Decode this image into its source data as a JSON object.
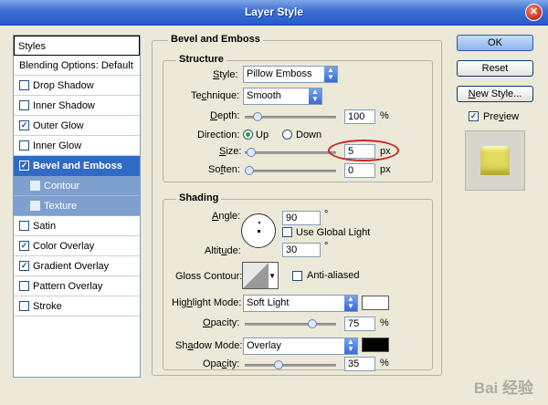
{
  "window": {
    "title": "Layer Style"
  },
  "styles_panel": {
    "header": "Styles",
    "items": [
      {
        "label": "Blending Options: Default",
        "checkbox": false,
        "checked": false,
        "state": "normal"
      },
      {
        "label": "Drop Shadow",
        "checkbox": true,
        "checked": false,
        "state": "normal"
      },
      {
        "label": "Inner Shadow",
        "checkbox": true,
        "checked": false,
        "state": "normal"
      },
      {
        "label": "Outer Glow",
        "checkbox": true,
        "checked": true,
        "state": "normal"
      },
      {
        "label": "Inner Glow",
        "checkbox": true,
        "checked": false,
        "state": "normal"
      },
      {
        "label": "Bevel and Emboss",
        "checkbox": true,
        "checked": true,
        "state": "selected"
      },
      {
        "label": "Contour",
        "checkbox": true,
        "checked": false,
        "state": "sub"
      },
      {
        "label": "Texture",
        "checkbox": true,
        "checked": false,
        "state": "sub"
      },
      {
        "label": "Satin",
        "checkbox": true,
        "checked": false,
        "state": "normal"
      },
      {
        "label": "Color Overlay",
        "checkbox": true,
        "checked": true,
        "state": "normal"
      },
      {
        "label": "Gradient Overlay",
        "checkbox": true,
        "checked": true,
        "state": "normal"
      },
      {
        "label": "Pattern Overlay",
        "checkbox": true,
        "checked": false,
        "state": "normal"
      },
      {
        "label": "Stroke",
        "checkbox": true,
        "checked": false,
        "state": "normal"
      }
    ]
  },
  "bevel": {
    "heading": "Bevel and Emboss",
    "structure": {
      "title": "Structure",
      "style_label": "Style:",
      "style_value": "Pillow Emboss",
      "technique_label": "Technique:",
      "technique_value": "Smooth",
      "depth_label": "Depth:",
      "depth_value": "100",
      "depth_unit": "%",
      "depth_level": 0.1,
      "direction_label": "Direction:",
      "direction_up": "Up",
      "direction_down": "Down",
      "direction_selected": "Up",
      "size_label": "Size:",
      "size_value": "5",
      "size_unit": "px",
      "size_level": 0.02,
      "soften_label": "Soften:",
      "soften_value": "0",
      "soften_unit": "px",
      "soften_level": 0.0
    },
    "shading": {
      "title": "Shading",
      "angle_label": "Angle:",
      "angle_value": "90",
      "angle_unit": "°",
      "use_global_light_label": "Use Global Light",
      "use_global_light_checked": false,
      "altitude_label": "Altitude:",
      "altitude_value": "30",
      "altitude_unit": "°",
      "gloss_contour_label": "Gloss Contour:",
      "anti_aliased_label": "Anti-aliased",
      "anti_aliased_checked": false,
      "highlight_mode_label": "Highlight Mode:",
      "highlight_mode_value": "Soft Light",
      "highlight_color": "#ffffff",
      "highlight_opacity_label": "Opacity:",
      "highlight_opacity_value": "75",
      "highlight_opacity_unit": "%",
      "highlight_opacity_level": 0.75,
      "shadow_mode_label": "Shadow Mode:",
      "shadow_mode_value": "Overlay",
      "shadow_color": "#000000",
      "shadow_opacity_label": "Opacity:",
      "shadow_opacity_value": "35",
      "shadow_opacity_unit": "%",
      "shadow_opacity_level": 0.35
    }
  },
  "buttons": {
    "ok": "OK",
    "reset": "Reset",
    "new_style": "New Style...",
    "preview_label": "Preview",
    "preview_checked": true
  },
  "colors": {
    "titlebar": "#2a5bc9",
    "selection": "#316ac5",
    "highlight_ring": "#c8252a",
    "preview_swatch": "#e2da5a"
  },
  "watermark": "Bai 经验"
}
